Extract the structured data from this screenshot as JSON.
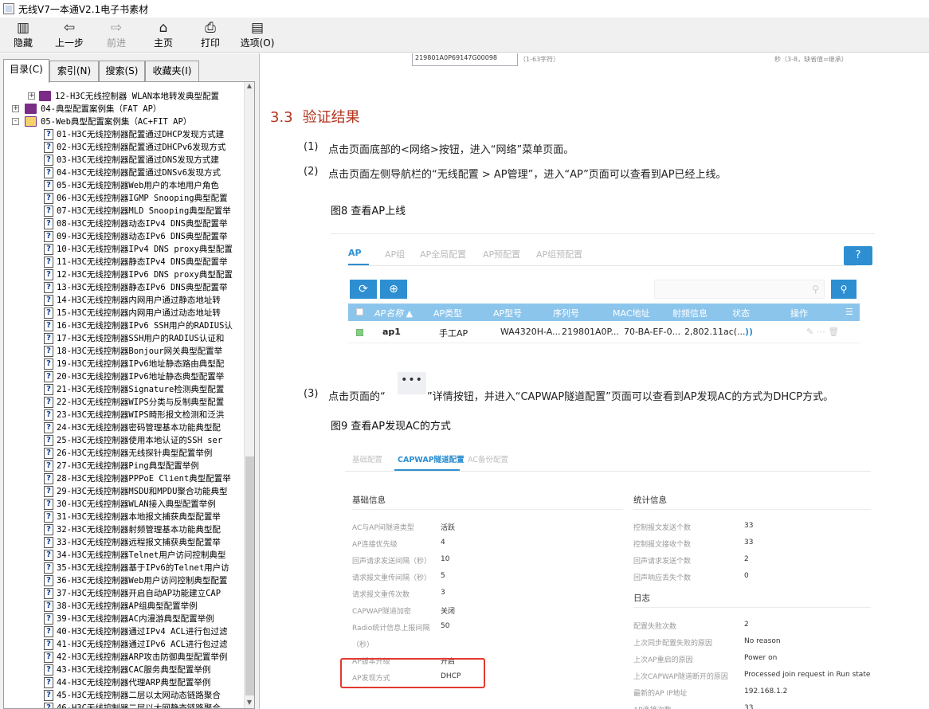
{
  "window": {
    "title": "无线V7一本通V2.1电子书素材"
  },
  "toolbar": {
    "hide": "隐藏",
    "back": "上一步",
    "forward": "前进",
    "home": "主页",
    "print": "打印",
    "options": "选项(O)"
  },
  "tabs": [
    "目录(C)",
    "索引(N)",
    "搜索(S)",
    "收藏夹(I)"
  ],
  "tree": {
    "nodes": [
      {
        "label": "12-H3C无线控制器 WLAN本地转发典型配置",
        "type": "book",
        "toggle": "+"
      },
      {
        "label": "04-典型配置案例集（FAT AP）",
        "type": "book",
        "toggle": "+"
      },
      {
        "label": "05-Web典型配置案例集（AC+FIT AP）",
        "type": "openbook",
        "toggle": "-"
      }
    ],
    "pages": [
      "01-H3C无线控制器配置通过DHCP发现方式建",
      "02-H3C无线控制器配置通过DHCPv6发现方式",
      "03-H3C无线控制器配置通过DNS发现方式建",
      "04-H3C无线控制器配置通过DNSv6发现方式",
      "05-H3C无线控制器Web用户的本地用户角色",
      "06-H3C无线控制器IGMP Snooping典型配置",
      "07-H3C无线控制器MLD Snooping典型配置举",
      "08-H3C无线控制器动态IPv4 DNS典型配置举",
      "09-H3C无线控制器动态IPv6 DNS典型配置举",
      "10-H3C无线控制器IPv4 DNS proxy典型配置",
      "11-H3C无线控制器静态IPv4 DNS典型配置举",
      "12-H3C无线控制器IPv6 DNS proxy典型配置",
      "13-H3C无线控制器静态IPv6 DNS典型配置举",
      "14-H3C无线控制器内网用户通过静态地址转",
      "15-H3C无线控制器内网用户通过动态地址转",
      "16-H3C无线控制器IPv6 SSH用户的RADIUS认",
      "17-H3C无线控制器SSH用户的RADIUS认证和",
      "18-H3C无线控制器Bonjour网关典型配置举",
      "19-H3C无线控制器IPv6地址静态路由典型配",
      "20-H3C无线控制器IPv6地址静态典型配置举",
      "21-H3C无线控制器Signature检测典型配置",
      "22-H3C无线控制器WIPS分类与反制典型配置",
      "23-H3C无线控制器WIPS畸形报文检测和泛洪",
      "24-H3C无线控制器密码管理基本功能典型配",
      "25-H3C无线控制器使用本地认证的SSH ser",
      "26-H3C无线控制器无线探针典型配置举例",
      "27-H3C无线控制器Ping典型配置举例",
      "28-H3C无线控制器PPPoE Client典型配置举",
      "29-H3C无线控制器MSDU和MPDU聚合功能典型",
      "30-H3C无线控制器WLAN接入典型配置举例",
      "31-H3C无线控制器本地报文捕获典型配置举",
      "32-H3C无线控制器射频管理基本功能典型配",
      "33-H3C无线控制器远程报文捕获典型配置举",
      "34-H3C无线控制器Telnet用户访问控制典型",
      "35-H3C无线控制器基于IPv6的Telnet用户访",
      "36-H3C无线控制器Web用户访问控制典型配置",
      "37-H3C无线控制器开启自动AP功能建立CAP",
      "38-H3C无线控制器AP组典型配置举例",
      "39-H3C无线控制器AC内漫游典型配置举例",
      "40-H3C无线控制器通过IPv4 ACL进行包过滤",
      "41-H3C无线控制器通过IPv6 ACL进行包过滤",
      "42-H3C无线控制器ARP攻击防御典型配置举例",
      "43-H3C无线控制器CAC服务典型配置举例",
      "44-H3C无线控制器代理ARP典型配置举例",
      "45-H3C无线控制器二层以太网动态链路聚合",
      "46-H3C无线控制器二层以太网静态链路聚合"
    ]
  },
  "content": {
    "top_fragment": {
      "serial": "219801A0P69147G00098",
      "hint1": "（1-63字符）",
      "hint2": "秒（3-8，缺省值=继承）"
    },
    "section": {
      "number": "3.3",
      "title": "验证结果"
    },
    "steps": [
      {
        "num": "(1)",
        "text": "点击页面底部的<网络>按钮，进入“网络”菜单页面。"
      },
      {
        "num": "(2)",
        "text": "点击页面左侧导航栏的“无线配置 > AP管理”，进入“AP”页面可以查看到AP已经上线。"
      },
      {
        "num": "(3)",
        "text_before": "点击页面的“",
        "button": "•••",
        "text_after": "”详情按钮，并进入“CAPWAP隧道配置”页面可以查看到AP发现AC的方式为DHCP方式。"
      }
    ],
    "fig8_caption": "图8 查看AP上线",
    "fig9_caption": "图9 查看AP发现AC的方式"
  },
  "fig8": {
    "tabs": [
      "AP",
      "AP组",
      "AP全局配置",
      "AP预配置",
      "AP组预配置"
    ],
    "help": "?",
    "columns": [
      "AP名称 ▲",
      "AP类型",
      "AP型号",
      "序列号",
      "MAC地址",
      "射频信息",
      "状态",
      "操作"
    ],
    "row": {
      "name": "ap1",
      "type": "手工AP",
      "model": "WA4320H-A...",
      "serial": "219801A0P...",
      "mac": "70-BA-EF-0...",
      "radio": "2,802.11ac(..."
    }
  },
  "fig9": {
    "tabs": [
      "基础配置",
      "CAPWAP隧道配置",
      "AC备份配置"
    ],
    "basic_title": "基础信息",
    "basic": [
      {
        "k": "AC与AP间隧道类型",
        "v": "活跃"
      },
      {
        "k": "AP连接优先级",
        "v": "4"
      },
      {
        "k": "回声请求发送间隔（秒）",
        "v": "10"
      },
      {
        "k": "请求报文重传间隔（秒）",
        "v": "5"
      },
      {
        "k": "请求报文重传次数",
        "v": "3"
      },
      {
        "k": "CAPWAP隧道加密",
        "v": "关闭"
      },
      {
        "k": "Radio统计信息上报间隔",
        "v": "50"
      },
      {
        "k": "（秒）",
        "v": ""
      },
      {
        "k": "AP版本升级",
        "v": "开启"
      },
      {
        "k": "AP发现方式",
        "v": "DHCP"
      }
    ],
    "stats_title": "统计信息",
    "stats": [
      {
        "k": "控制报文发送个数",
        "v": "33"
      },
      {
        "k": "控制报文接收个数",
        "v": "33"
      },
      {
        "k": "回声请求发送个数",
        "v": "2"
      },
      {
        "k": "回声响应丢失个数",
        "v": "0"
      }
    ],
    "log_title": "日志",
    "log": [
      {
        "k": "配置失败次数",
        "v": "2"
      },
      {
        "k": "上次同步配置失败的原因",
        "v": "No reason"
      },
      {
        "k": "上次AP重启的原因",
        "v": "Power on"
      },
      {
        "k": "上次CAPWAP隧道断开的原因",
        "v": "Processed join request in Run state"
      },
      {
        "k": "最新的AP IP地址",
        "v": "192.168.1.2"
      },
      {
        "k": "AP连接次数",
        "v": "33"
      }
    ]
  }
}
